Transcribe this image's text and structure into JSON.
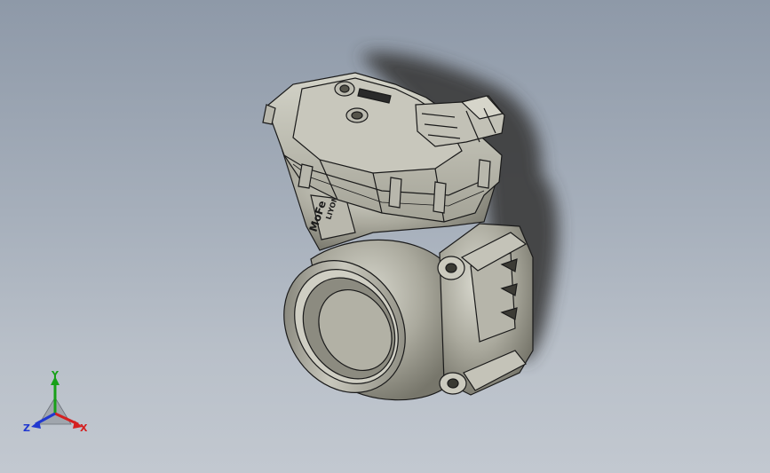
{
  "viewport": {
    "background_top": "#8e99a8",
    "background_bottom": "#c2c8d0"
  },
  "model": {
    "body_color": "#a8a89c",
    "shadow_color": "#3a3a3a",
    "part_label": "MoFe",
    "part_code": "LIYOM"
  },
  "triad": {
    "x_label": "X",
    "y_label": "Y",
    "z_label": "Z",
    "x_color": "#d42020",
    "y_color": "#18a018",
    "z_color": "#2038d0"
  }
}
